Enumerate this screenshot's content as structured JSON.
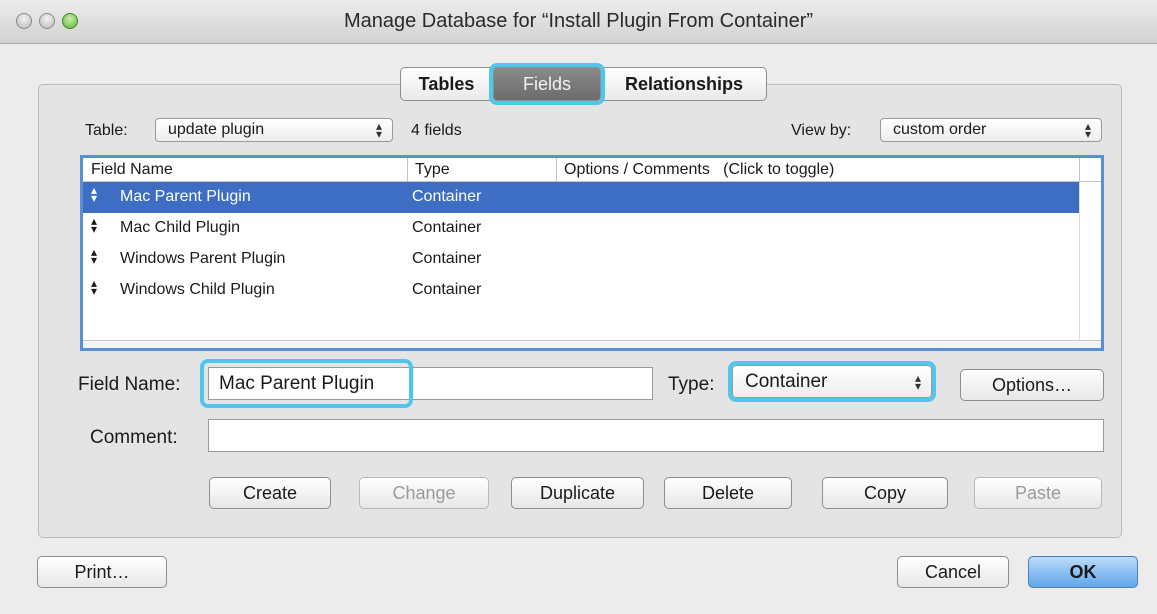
{
  "window": {
    "title": "Manage Database for “Install Plugin From Container”"
  },
  "tabs": [
    {
      "label": "Tables"
    },
    {
      "label": "Fields"
    },
    {
      "label": "Relationships"
    }
  ],
  "toolbar": {
    "table_label": "Table:",
    "table_value": "update plugin",
    "field_count": "4 fields",
    "viewby_label": "View by:",
    "viewby_value": "custom order"
  },
  "list": {
    "columns": [
      "Field Name",
      "Type",
      "Options / Comments   (Click to toggle)"
    ],
    "rows": [
      {
        "name": "Mac Parent Plugin",
        "type": "Container"
      },
      {
        "name": "Mac Child Plugin",
        "type": "Container"
      },
      {
        "name": "Windows Parent Plugin",
        "type": "Container"
      },
      {
        "name": "Windows Child Plugin",
        "type": "Container"
      }
    ]
  },
  "form": {
    "field_name_label": "Field Name:",
    "field_name_value": "Mac Parent Plugin",
    "type_label": "Type:",
    "type_value": "Container",
    "options_label": "Options…",
    "comment_label": "Comment:",
    "comment_value": ""
  },
  "actions": {
    "create": "Create",
    "change": "Change",
    "duplicate": "Duplicate",
    "delete": "Delete",
    "copy": "Copy",
    "paste": "Paste"
  },
  "footer": {
    "print": "Print…",
    "cancel": "Cancel",
    "ok": "OK"
  },
  "colors": {
    "selection": "#3d6ec3",
    "focus_ring": "#4fc6ec",
    "default_button": "#5fa6ea"
  }
}
